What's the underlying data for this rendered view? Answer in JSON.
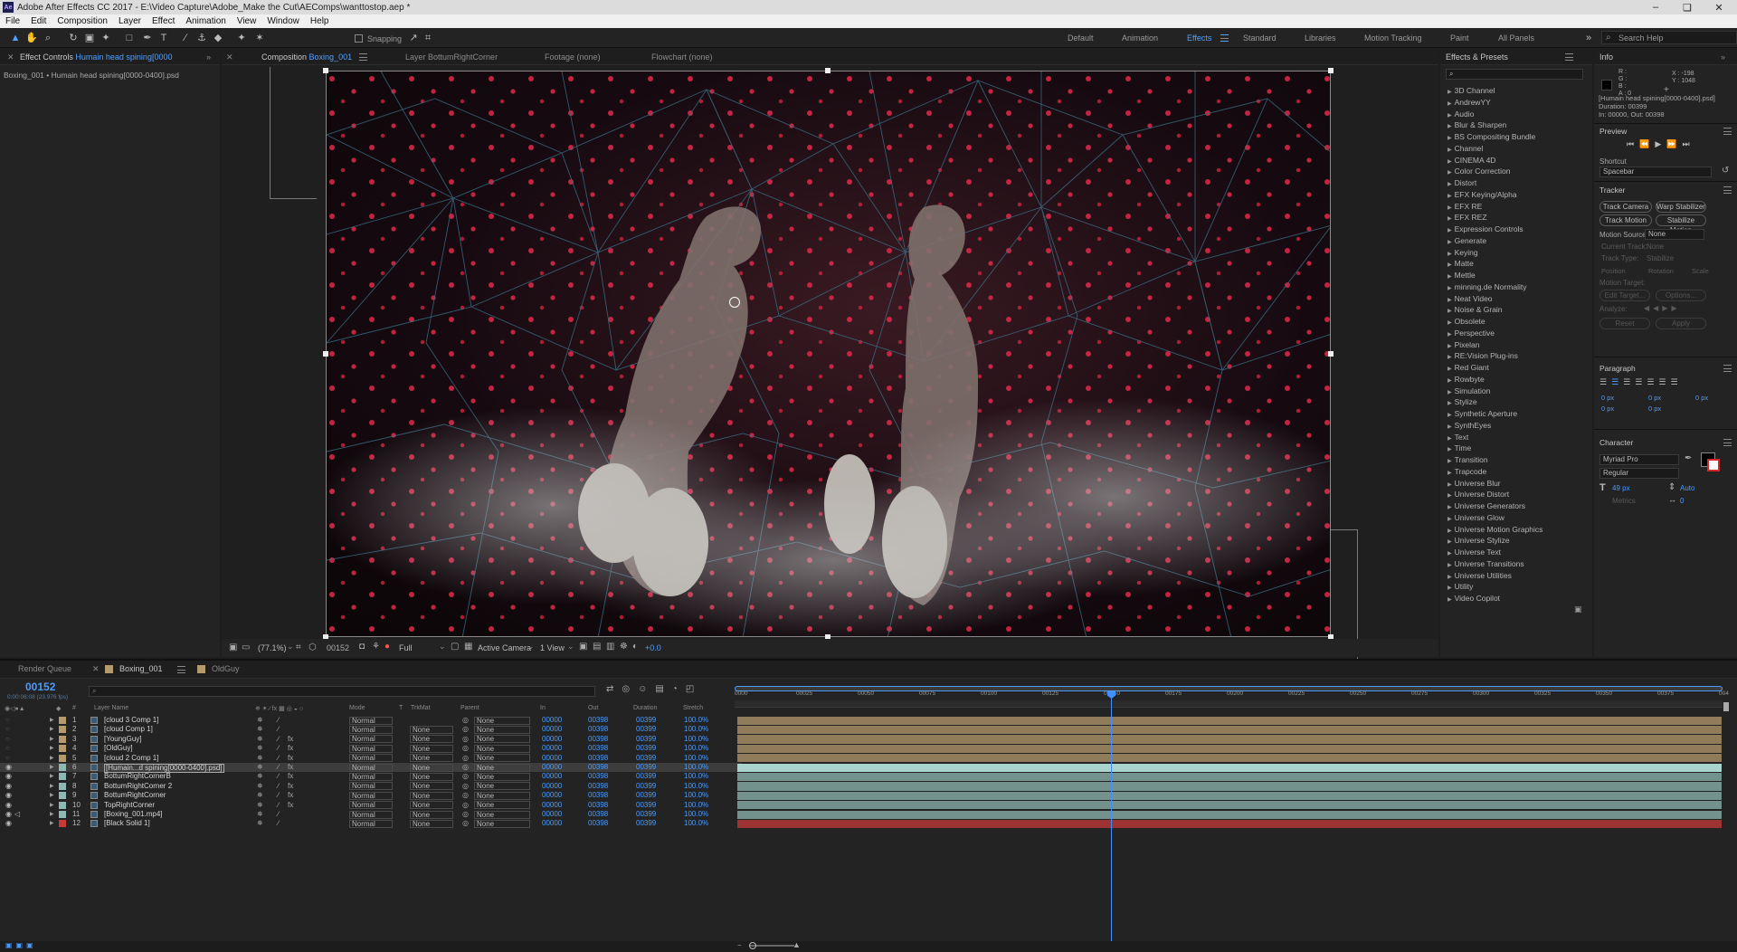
{
  "window": {
    "title": "Adobe After Effects CC 2017 - E:\\Video Capture\\Adobe_Make the Cut\\AEComps\\wanttostop.aep *",
    "controls": [
      "–",
      "❏",
      "✕"
    ]
  },
  "menu": [
    "File",
    "Edit",
    "Composition",
    "Layer",
    "Effect",
    "Animation",
    "View",
    "Window",
    "Help"
  ],
  "toolbar": {
    "snapping_label": "Snapping",
    "workspaces": [
      "Default",
      "Animation",
      "Effects",
      "Standard",
      "Libraries",
      "Motion Tracking",
      "Paint",
      "All Panels"
    ],
    "active_workspace": "Effects",
    "search_placeholder": "Search Help"
  },
  "project_panel": {
    "tab_label": "Effect Controls",
    "tab_item": "Humain head spining[0000",
    "breadcrumb": "Boxing_001 • Humain head spining[0000-0400].psd"
  },
  "viewer": {
    "tabs": [
      {
        "label": "Composition",
        "item": "Boxing_001"
      },
      {
        "label": "Layer",
        "item": "BottumRightCorner"
      },
      {
        "label": "Footage",
        "item": "(none)"
      },
      {
        "label": "Flowchart",
        "item": "(none)"
      }
    ],
    "footer": {
      "zoom": "(77.1%)",
      "timecode": "00152",
      "resolution": "Full",
      "camera": "Active Camera",
      "view": "1 View",
      "exposure": "+0.0"
    }
  },
  "effects_presets": {
    "title": "Effects & Presets",
    "search_placeholder": "⌕",
    "categories": [
      "3D Channel",
      "AndrewYY",
      "Audio",
      "Blur & Sharpen",
      "BS Compositing Bundle",
      "Channel",
      "CINEMA 4D",
      "Color Correction",
      "Distort",
      "EFX Keying/Alpha",
      "EFX RE",
      "EFX REZ",
      "Expression Controls",
      "Generate",
      "Keying",
      "Matte",
      "Mettle",
      "minning.de Normality",
      "Neat Video",
      "Noise & Grain",
      "Obsolete",
      "Perspective",
      "Pixelan",
      "RE:Vision Plug-ins",
      "Red Giant",
      "Rowbyte",
      "Simulation",
      "Stylize",
      "Synthetic Aperture",
      "SynthEyes",
      "Text",
      "Time",
      "Transition",
      "Trapcode",
      "Universe Blur",
      "Universe Distort",
      "Universe Generators",
      "Universe Glow",
      "Universe Motion Graphics",
      "Universe Stylize",
      "Universe Text",
      "Universe Transitions",
      "Universe Utilities",
      "Utility",
      "Video Copilot"
    ]
  },
  "info": {
    "title": "Info",
    "rgba_labels": [
      "R :",
      "G :",
      "B :",
      "A : 0"
    ],
    "x": "X : -198",
    "y": "Y : 1048",
    "file": "[Humain head spining[0000-0400].psd]",
    "duration": "Duration: 00399",
    "inout": "In: 00000, Out: 00398"
  },
  "preview": {
    "title": "Preview",
    "shortcut_label": "Shortcut",
    "shortcut_value": "Spacebar"
  },
  "tracker": {
    "title": "Tracker",
    "buttons": [
      "Track Camera",
      "Warp Stabilizer",
      "Track Motion",
      "Stabilize Motion"
    ],
    "motion_source_label": "Motion Source:",
    "motion_source_value": "None",
    "current_track_label": "Current Track:",
    "current_track_value": "None",
    "track_type_label": "Track Type:",
    "track_type_value": "Stabilize",
    "options": [
      "Position",
      "Rotation",
      "Scale"
    ],
    "motion_target": "Motion Target:",
    "edit_target": "Edit Target...",
    "options_btn": "Options...",
    "analyze": "Analyze:",
    "reset": "Reset",
    "apply": "Apply"
  },
  "paragraph": {
    "title": "Paragraph",
    "values": [
      "0 px",
      "0 px",
      "0 px",
      "0 px",
      "0 px"
    ]
  },
  "character": {
    "title": "Character",
    "font": "Myriad Pro",
    "style": "Regular",
    "size": "49 px",
    "leading": "Auto",
    "metrics": "Metrics",
    "tracking": "0"
  },
  "timeline": {
    "tabs": [
      "Render Queue",
      "Boxing_001",
      "OldGuy"
    ],
    "timecode": "00152",
    "timecode_sub": "0:00:06:08 (23.976 fps)",
    "columns": [
      "Layer Name",
      "Mode",
      "T",
      "TrkMat",
      "Parent",
      "In",
      "Out",
      "Duration",
      "Stretch"
    ],
    "ruler": [
      "0000",
      "00025",
      "00050",
      "00075",
      "00100",
      "00125",
      "00150",
      "00175",
      "00200",
      "00225",
      "00250",
      "00275",
      "00300",
      "00325",
      "00350",
      "00375",
      "004"
    ],
    "layers": [
      {
        "num": "1",
        "name": "[cloud 3 Comp 1]",
        "mode": "Normal",
        "trkmat": "",
        "parent": "None",
        "in": "00000",
        "out": "00398",
        "dur": "00399",
        "stretch": "100.0%",
        "label": "#b59a6e"
      },
      {
        "num": "2",
        "name": "[cloud Comp 1]",
        "mode": "Normal",
        "trkmat": "None",
        "parent": "None",
        "in": "00000",
        "out": "00398",
        "dur": "00399",
        "stretch": "100.0%",
        "label": "#b59a6e"
      },
      {
        "num": "3",
        "name": "[YoungGuy]",
        "mode": "Normal",
        "trkmat": "None",
        "parent": "None",
        "in": "00000",
        "out": "00398",
        "dur": "00399",
        "stretch": "100.0%",
        "label": "#b59a6e"
      },
      {
        "num": "4",
        "name": "[OldGuy]",
        "mode": "Normal",
        "trkmat": "None",
        "parent": "None",
        "in": "00000",
        "out": "00398",
        "dur": "00399",
        "stretch": "100.0%",
        "label": "#b59a6e"
      },
      {
        "num": "5",
        "name": "[cloud 2 Comp 1]",
        "mode": "Normal",
        "trkmat": "None",
        "parent": "None",
        "in": "00000",
        "out": "00398",
        "dur": "00399",
        "stretch": "100.0%",
        "label": "#b59a6e"
      },
      {
        "num": "6",
        "name": "[Humain...d spining[0000-0400].psd]",
        "mode": "Normal",
        "trkmat": "None",
        "parent": "None",
        "in": "00000",
        "out": "00398",
        "dur": "00399",
        "stretch": "100.0%",
        "label": "#8fb8b3"
      },
      {
        "num": "7",
        "name": "BottumRightCornerB",
        "mode": "Normal",
        "trkmat": "None",
        "parent": "None",
        "in": "00000",
        "out": "00398",
        "dur": "00399",
        "stretch": "100.0%",
        "label": "#8fb8b3"
      },
      {
        "num": "8",
        "name": "BottumRightCorner 2",
        "mode": "Normal",
        "trkmat": "None",
        "parent": "None",
        "in": "00000",
        "out": "00398",
        "dur": "00399",
        "stretch": "100.0%",
        "label": "#8fb8b3"
      },
      {
        "num": "9",
        "name": "BottumRightCorner",
        "mode": "Normal",
        "trkmat": "None",
        "parent": "None",
        "in": "00000",
        "out": "00398",
        "dur": "00399",
        "stretch": "100.0%",
        "label": "#8fb8b3"
      },
      {
        "num": "10",
        "name": "TopRightCorner",
        "mode": "Normal",
        "trkmat": "None",
        "parent": "None",
        "in": "00000",
        "out": "00398",
        "dur": "00399",
        "stretch": "100.0%",
        "label": "#8fb8b3"
      },
      {
        "num": "11",
        "name": "[Boxing_001.mp4]",
        "mode": "Normal",
        "trkmat": "None",
        "parent": "None",
        "in": "00000",
        "out": "00398",
        "dur": "00399",
        "stretch": "100.0%",
        "label": "#8fb8b3"
      },
      {
        "num": "12",
        "name": "[Black Solid 1]",
        "mode": "Normal",
        "trkmat": "None",
        "parent": "None",
        "in": "00000",
        "out": "00398",
        "dur": "00399",
        "stretch": "100.0%",
        "label": "#c73a3a"
      }
    ]
  },
  "colors": {
    "accent": "#4fa0ff",
    "playhead": "#3f8fff"
  }
}
